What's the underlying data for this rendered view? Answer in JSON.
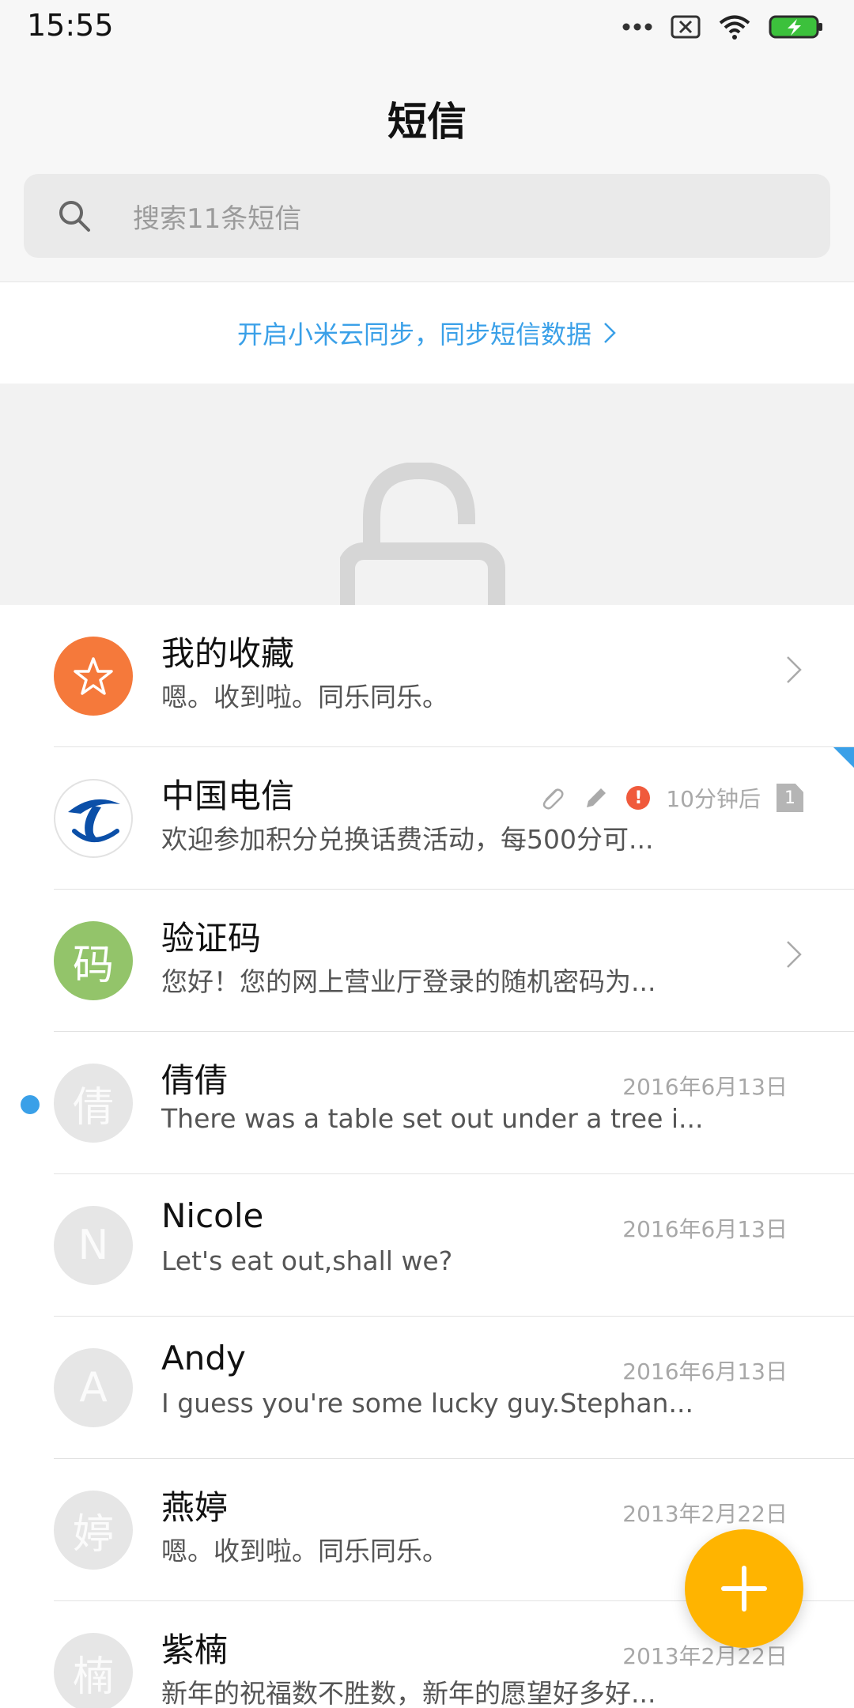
{
  "status_bar": {
    "time": "15:55"
  },
  "header": {
    "title": "短信"
  },
  "search": {
    "placeholder": "搜索11条短信"
  },
  "sync_banner": {
    "text": "开启小米云同步，同步短信数据"
  },
  "conversations": [
    {
      "name": "我的收藏",
      "preview": "嗯。收到啦。同乐同乐。",
      "avatar_icon": "star-icon",
      "has_chevron": true
    },
    {
      "name": "中国电信",
      "preview": "欢迎参加积分兑换话费活动，每500分可...",
      "meta_time": "10分钟后",
      "sim": "1",
      "meta_icons": [
        "paperclip-icon",
        "pencil-icon",
        "error-icon"
      ]
    },
    {
      "name": "验证码",
      "preview": "您好！您的网上营业厅登录的随机密码为...",
      "avatar_text": "码",
      "has_chevron": true
    },
    {
      "name": "倩倩",
      "preview": "There was a table set out under a tree i...",
      "avatar_text": "倩",
      "date": "2016年6月13日",
      "unread": true
    },
    {
      "name": "Nicole",
      "preview": "Let's eat out,shall we?",
      "avatar_text": "N",
      "date": "2016年6月13日"
    },
    {
      "name": "Andy",
      "preview": "I guess you're some lucky guy.Stephan...",
      "avatar_text": "A",
      "date": "2016年6月13日"
    },
    {
      "name": "燕婷",
      "preview": "嗯。收到啦。同乐同乐。",
      "avatar_text": "婷",
      "date": "2013年2月22日"
    },
    {
      "name": "紫楠",
      "preview": "新年的祝福数不胜数，新年的愿望好多好...",
      "avatar_text": "楠",
      "date": "2013年2月22日"
    }
  ],
  "fab": {
    "icon": "plus-icon"
  },
  "colors": {
    "accent_blue": "#3aa0e8",
    "fab_yellow": "#ffb400",
    "favorites_orange": "#f5793b",
    "code_green": "#93c46a"
  }
}
